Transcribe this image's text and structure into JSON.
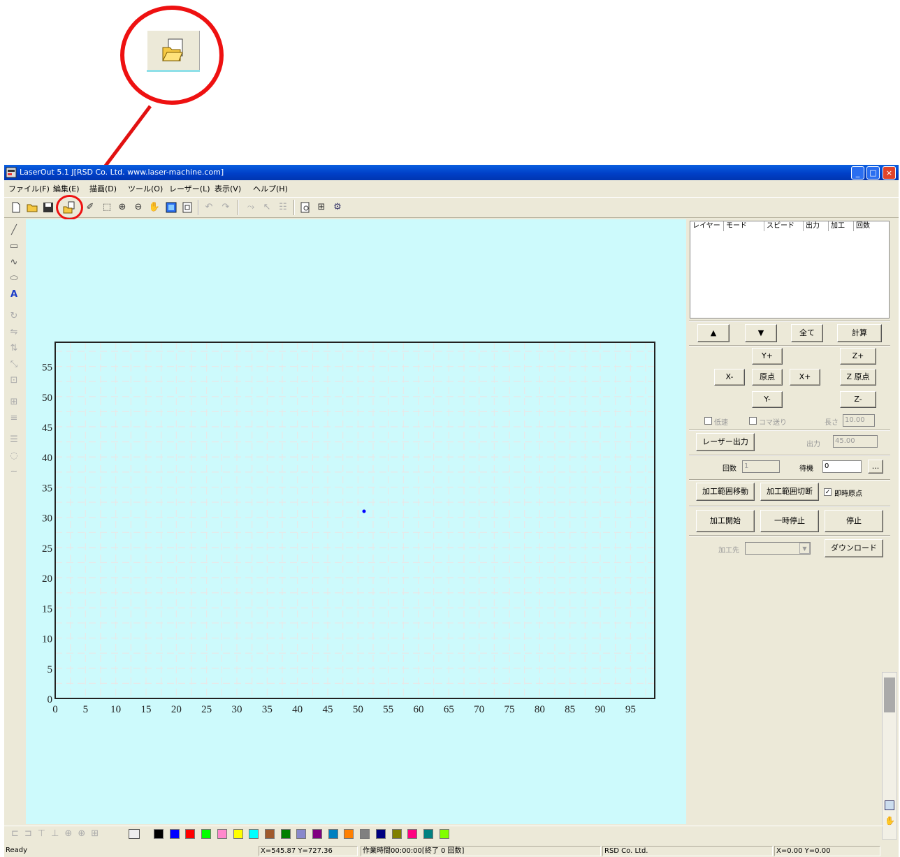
{
  "window": {
    "title": "LaserOut 5.1 J[RSD Co. Ltd. www.laser-machine.com]",
    "minimize": "_",
    "maximize": "□",
    "close": "×"
  },
  "menu": [
    "ファイル(F)",
    "編集(E)",
    "描画(D)",
    "ツール(O)",
    "レーザー(L)",
    "表示(V)",
    "ヘルプ(H)"
  ],
  "layer_table": {
    "headers": [
      "レイヤー",
      "モード",
      "スピード",
      "出力",
      "加工",
      "回数"
    ]
  },
  "panel": {
    "up": "▲",
    "down": "▼",
    "all": "全て",
    "calc": "計算",
    "y_plus": "Y+",
    "x_minus": "X-",
    "origin": "原点",
    "x_plus": "X+",
    "y_minus": "Y-",
    "z_plus": "Z+",
    "z_origin": "Z 原点",
    "z_minus": "Z-",
    "low_speed": "低速",
    "step": "コマ送り",
    "length_label": "長さ",
    "length_value": "10.00",
    "laser_output_btn": "レーザー出力",
    "output_label": "出力",
    "output_value": "45.00",
    "count_label": "回数",
    "count_value": "1",
    "wait_label": "待機",
    "wait_value": "0",
    "more": "...",
    "range_move": "加工範囲移動",
    "range_cut": "加工範囲切断",
    "return_origin": "即時原点",
    "start": "加工開始",
    "pause": "一時停止",
    "stop": "停止",
    "target_label": "加工先",
    "download": "ダウンロード"
  },
  "chart_data": {
    "type": "scatter",
    "title": "",
    "xlabel": "",
    "ylabel": "",
    "xlim": [
      0,
      99
    ],
    "ylim": [
      0,
      59
    ],
    "xticks": [
      0,
      5,
      10,
      15,
      20,
      25,
      30,
      35,
      40,
      45,
      50,
      55,
      60,
      65,
      70,
      75,
      80,
      85,
      90,
      95
    ],
    "yticks": [
      0,
      5,
      10,
      15,
      20,
      25,
      30,
      35,
      40,
      45,
      50,
      55
    ],
    "grid": true,
    "points": [
      {
        "x": 51,
        "y": 31
      }
    ],
    "point_color": "#0000ff"
  },
  "palette": [
    "#000000",
    "#0000ff",
    "#ff0000",
    "#00ff00",
    "#ff88cc",
    "#ffff00",
    "#00ffff",
    "#a05a2c",
    "#008000",
    "#8888cc",
    "#800080",
    "#0080c0",
    "#ff8000",
    "#808080",
    "#000080",
    "#808000",
    "#ff0080",
    "#008080",
    "#80ff00"
  ],
  "status": {
    "ready": "Ready",
    "coords": "X=545.87 Y=727.36",
    "work_time": "作業時間00:00:00[終了 0 回数]",
    "company": "RSD Co. Ltd.",
    "pos": "X=0.00 Y=0.00"
  },
  "colors": {
    "canvas_bg": "#cdfafc",
    "callout": "#e11111",
    "grid": "#e8e8e8"
  }
}
